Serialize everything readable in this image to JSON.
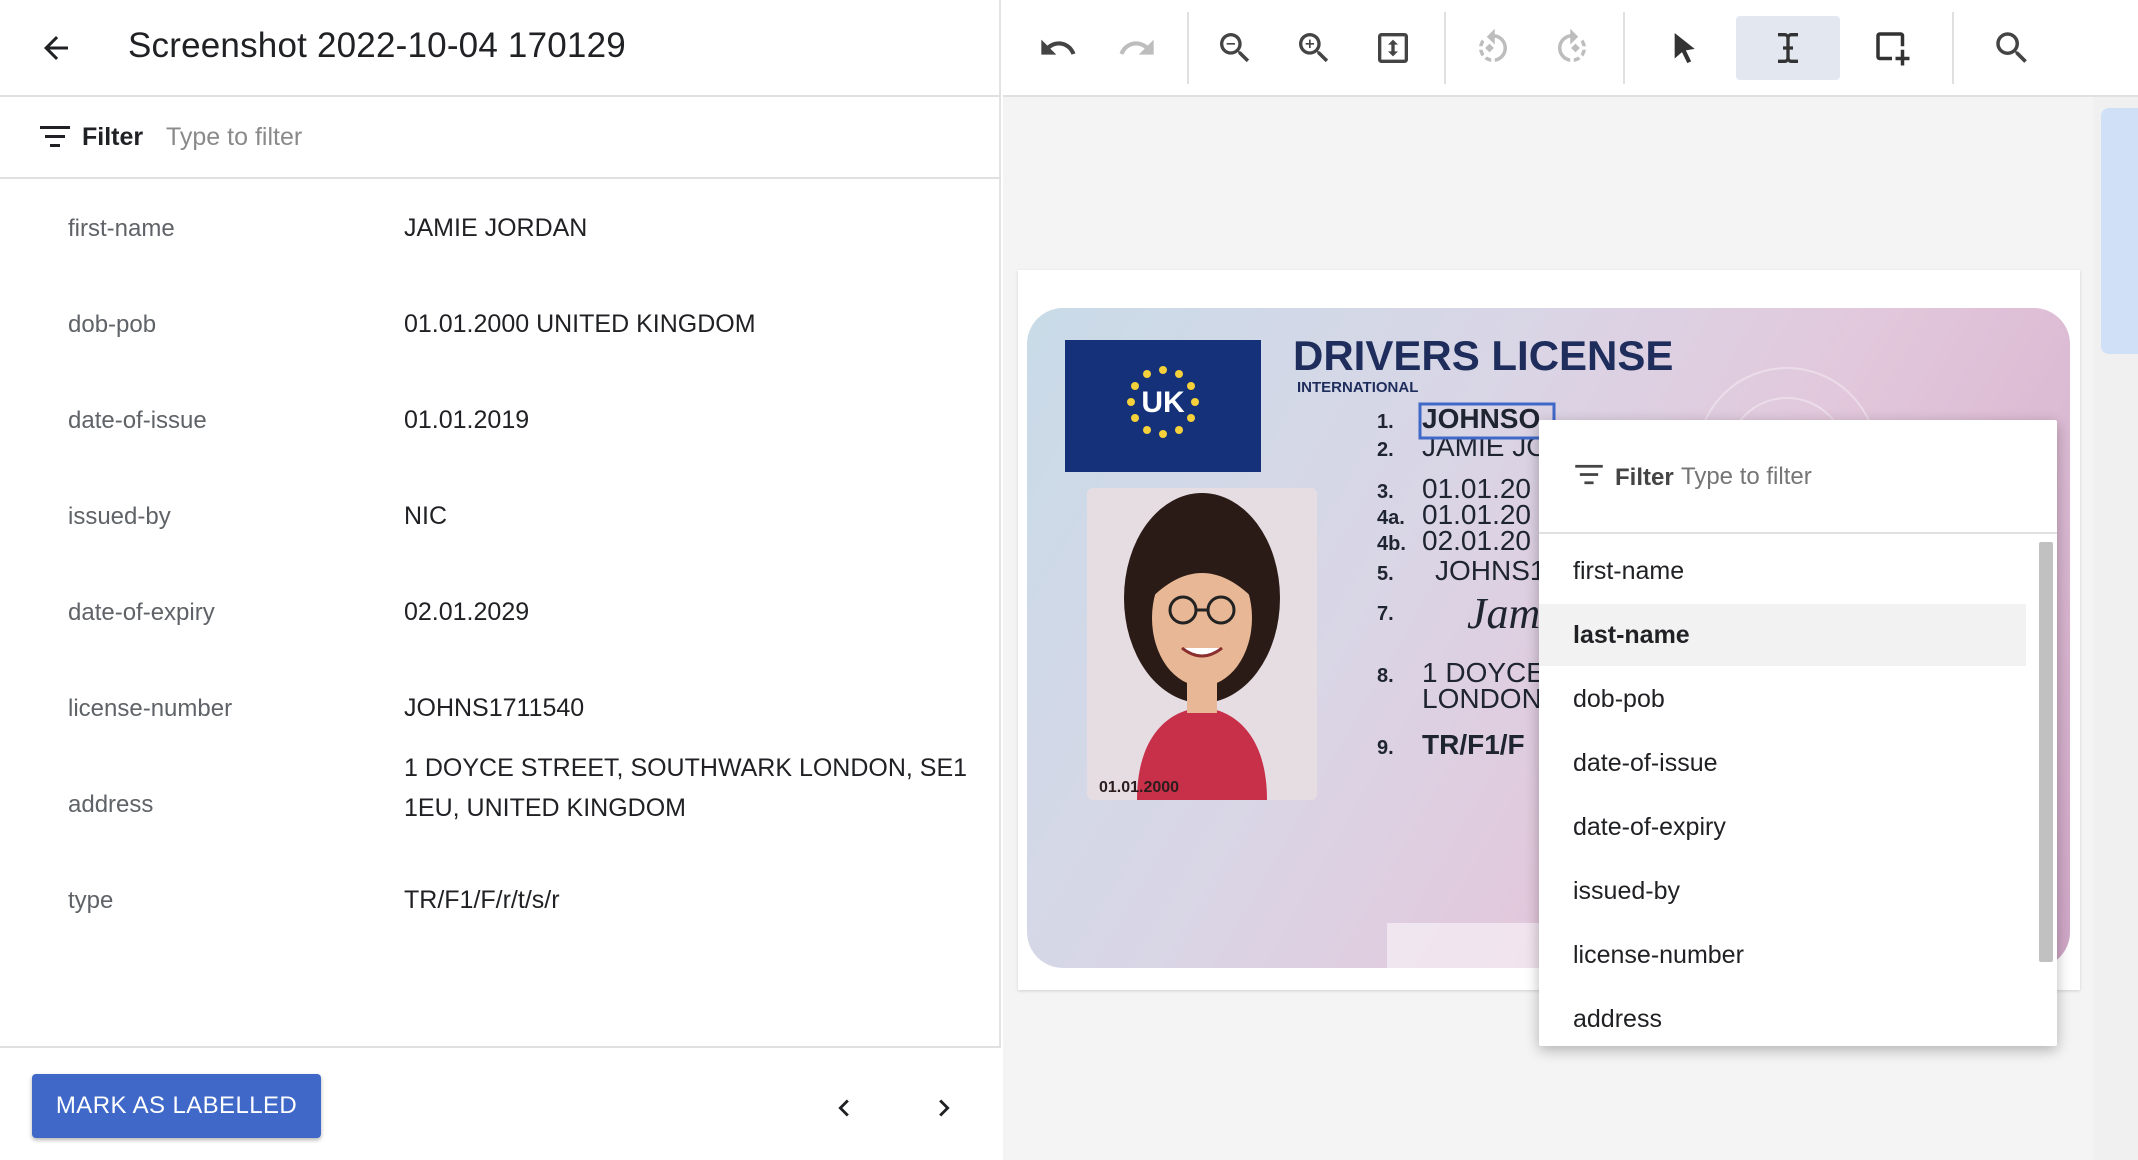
{
  "header": {
    "title": "Screenshot 2022-10-04 170129"
  },
  "filter": {
    "label": "Filter",
    "placeholder": "Type to filter"
  },
  "fields": [
    {
      "key": "first-name",
      "value": "JAMIE JORDAN"
    },
    {
      "key": "dob-pob",
      "value": "01.01.2000 UNITED KINGDOM"
    },
    {
      "key": "date-of-issue",
      "value": "01.01.2019"
    },
    {
      "key": "issued-by",
      "value": "NIC"
    },
    {
      "key": "date-of-expiry",
      "value": "02.01.2029"
    },
    {
      "key": "license-number",
      "value": "JOHNS1711540"
    },
    {
      "key": "address",
      "value": "1 DOYCE STREET, SOUTHWARK LONDON, SE1 1EU, UNITED KINGDOM"
    },
    {
      "key": "type",
      "value": "TR/F1/F/r/t/s/r"
    }
  ],
  "footer": {
    "mark_label": "MARK AS LABELLED"
  },
  "toolbar": {
    "tools": [
      "undo-icon",
      "redo-icon",
      "zoom-out-icon",
      "zoom-in-icon",
      "fit-page-icon",
      "rotate-left-icon",
      "rotate-right-icon",
      "select-pointer-icon",
      "text-select-icon",
      "add-box-icon",
      "search-icon"
    ],
    "active_tool": "text-select-icon",
    "accent": "#3f68c8"
  },
  "license_card": {
    "heading": "DRIVERS LICENSE",
    "subheading": "INTERNATIONAL",
    "country": "UK",
    "photo_date": "01.01.2000",
    "lines": [
      {
        "num": "1.",
        "text": "JOHNSO"
      },
      {
        "num": "2.",
        "text": "JAMIE JO"
      },
      {
        "num": "3.",
        "text": "01.01.20"
      },
      {
        "num": "4a.",
        "text": "01.01.20"
      },
      {
        "num": "4b.",
        "text": "02.01.20"
      },
      {
        "num": "5.",
        "text": "JOHNS1"
      },
      {
        "num": "7.",
        "text": "Jam"
      },
      {
        "num": "8.",
        "text": "1 DOYCE S"
      },
      {
        "num": "",
        "text": "LONDON,"
      },
      {
        "num": "9.",
        "text": "TR/F1/F"
      }
    ]
  },
  "dropdown": {
    "filter_label": "Filter",
    "filter_placeholder": "Type to filter",
    "items": [
      "first-name",
      "last-name",
      "dob-pob",
      "date-of-issue",
      "date-of-expiry",
      "issued-by",
      "license-number",
      "address"
    ],
    "highlighted": "last-name"
  }
}
